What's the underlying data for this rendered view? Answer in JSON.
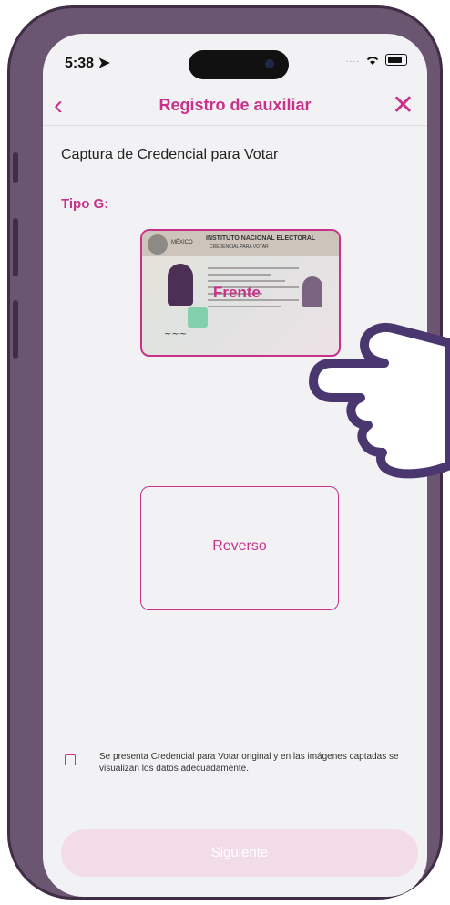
{
  "status_bar": {
    "time": "5:38",
    "dots": "....",
    "location_icon": "location-arrow-icon",
    "wifi_icon": "wifi-icon",
    "battery_icon": "battery-icon"
  },
  "nav": {
    "back_icon": "chevron-left-icon",
    "title": "Registro de auxiliar",
    "close_icon": "close-icon"
  },
  "content": {
    "section_title": "Captura de Credencial para Votar",
    "tipo_label": "Tipo G:",
    "front_card": {
      "country": "MÉXICO",
      "institution": "INSTITUTO NACIONAL ELECTORAL",
      "subtitle": "CREDENCIAL PARA VOTAR",
      "label": "Frente"
    },
    "back_card": {
      "label": "Reverso"
    },
    "consent_text": "Se presenta Credencial para Votar original y en las imágenes captadas se visualizan los datos adecuadamente.",
    "next_button": "Siguiente"
  },
  "colors": {
    "accent": "#c8328a",
    "frame": "#6b5671",
    "disabled_button": "#f1dce8"
  },
  "overlay": {
    "hand_icon": "pointing-hand-icon"
  }
}
